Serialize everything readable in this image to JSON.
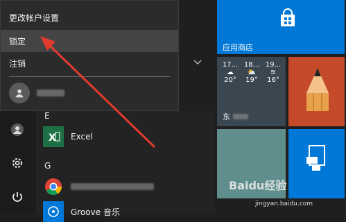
{
  "popup": {
    "items": [
      {
        "label": "更改帐户设置"
      },
      {
        "label": "锁定"
      },
      {
        "label": "注销"
      }
    ]
  },
  "applist": {
    "letter_e": "E",
    "letter_g": "G",
    "excel": "Excel",
    "groove": "Groove 音乐"
  },
  "tiles": {
    "store_label": "应用商店",
    "weather_times": [
      "17...",
      "18...",
      "19..."
    ],
    "weather_temps": [
      "20°",
      "19°",
      "16°"
    ],
    "weather_place": "东"
  },
  "watermark": {
    "brand": "Baidu经验",
    "url": "jingyan.baidu.com"
  },
  "colors": {
    "accent": "#0078d7",
    "arrow": "#e23b2e",
    "excel": "#1e7145"
  }
}
